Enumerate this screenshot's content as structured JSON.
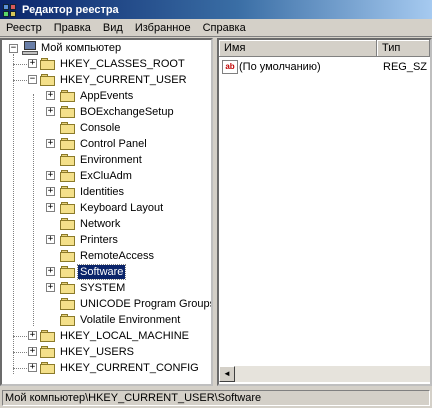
{
  "window": {
    "title": "Редактор реестра"
  },
  "menu": [
    "Реестр",
    "Правка",
    "Вид",
    "Избранное",
    "Справка"
  ],
  "tree": {
    "root": "Мой компьютер",
    "hkcr": "HKEY_CLASSES_ROOT",
    "hkcu": "HKEY_CURRENT_USER",
    "hkcu_children": [
      "AppEvents",
      "BOExchangeSetup",
      "Console",
      "Control Panel",
      "Environment",
      "ExCluAdm",
      "Identities",
      "Keyboard Layout",
      "Network",
      "Printers",
      "RemoteAccess",
      "Software",
      "SYSTEM",
      "UNICODE Program Groups",
      "Volatile Environment"
    ],
    "selected": "Software",
    "hklm": "HKEY_LOCAL_MACHINE",
    "hku": "HKEY_USERS",
    "hkcc": "HKEY_CURRENT_CONFIG"
  },
  "list": {
    "columns": {
      "name": "Имя",
      "type": "Тип"
    },
    "rows": [
      {
        "name": "(По умолчанию)",
        "type": "REG_SZ",
        "icon": "ab"
      }
    ]
  },
  "status": {
    "path": "Мой компьютер\\HKEY_CURRENT_USER\\Software"
  }
}
